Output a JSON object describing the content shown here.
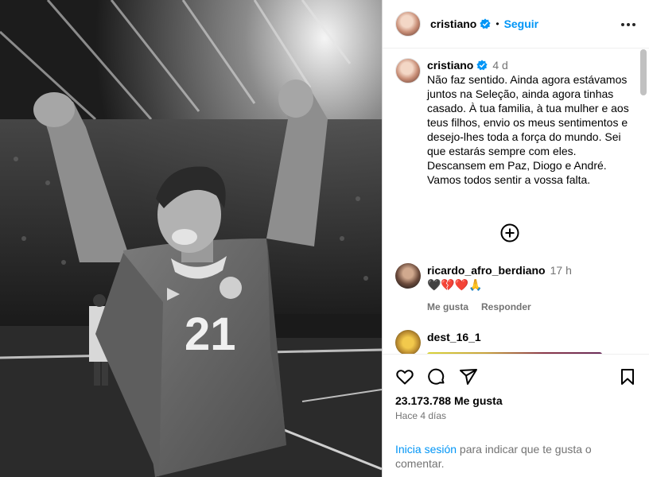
{
  "header": {
    "username": "cristiano",
    "follow_label": "Seguir",
    "dot": "•"
  },
  "caption": {
    "username": "cristiano",
    "age": "4 d",
    "text": "Não faz sentido. Ainda agora estávamos juntos na Seleção, ainda agora tinhas casado. À tua familia, à tua mulher e aos teus filhos, envio os meus sentimentos e desejo-lhes toda a força do mundo. Sei que estarás sempre com eles. Descansem em Paz, Diogo e André. Vamos todos sentir a vossa falta."
  },
  "comments": [
    {
      "username": "ricardo_afro_berdiano",
      "age": "17 h",
      "text": "🖤💔❤️🙏",
      "like_label": "Me gusta",
      "reply_label": "Responder"
    },
    {
      "username": "dest_16_1"
    }
  ],
  "photo": {
    "jersey_number": "21"
  },
  "footer": {
    "likes": "23.173.788 Me gusta",
    "time_ago": "Hace 4 días",
    "login_link": "Inicia sesión",
    "login_text": " para indicar que te gusta o comentar."
  },
  "colors": {
    "link": "#0095f6",
    "muted": "#737373"
  },
  "icons": [
    "verified-icon",
    "more-options-icon",
    "load-more-icon",
    "heart-icon",
    "comment-icon",
    "share-icon",
    "bookmark-icon"
  ]
}
